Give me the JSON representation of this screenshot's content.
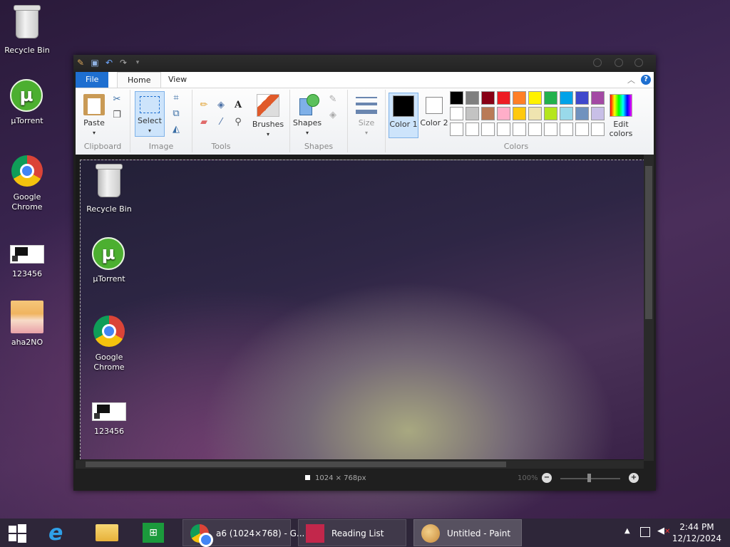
{
  "desktop": {
    "icons": [
      {
        "label": "Recycle Bin"
      },
      {
        "label": "µTorrent"
      },
      {
        "label": "Google Chrome"
      },
      {
        "label": "123456"
      },
      {
        "label": "aha2NO"
      }
    ]
  },
  "paint": {
    "tabs": {
      "file": "File",
      "home": "Home",
      "view": "View"
    },
    "help": "?",
    "clipboard": {
      "paste": "Paste",
      "label": "Clipboard"
    },
    "image": {
      "select": "Select",
      "label": "Image"
    },
    "tools": {
      "label": "Tools",
      "text_tool": "A"
    },
    "brushes": {
      "label": "Brushes"
    },
    "shapes": {
      "button": "Shapes",
      "label": "Shapes"
    },
    "size": {
      "label": "Size"
    },
    "colors": {
      "color1": "Color 1",
      "color2": "Color 2",
      "edit": "Edit colors",
      "label": "Colors",
      "row1": [
        "#000000",
        "#7f7f7f",
        "#880015",
        "#ed1c24",
        "#ff7f27",
        "#fff200",
        "#22b14c",
        "#00a2e8",
        "#3f48cc",
        "#a349a4"
      ],
      "row2": [
        "#ffffff",
        "#c3c3c3",
        "#b97a57",
        "#ffaec9",
        "#ffc90e",
        "#efe4b0",
        "#b5e61d",
        "#99d9ea",
        "#7092be",
        "#c8bfe7"
      ],
      "row3": [
        "#ffffff",
        "#ffffff",
        "#ffffff",
        "#ffffff",
        "#ffffff",
        "#ffffff",
        "#ffffff",
        "#ffffff",
        "#ffffff",
        "#ffffff"
      ]
    },
    "canvas_icons": [
      {
        "label": "Recycle Bin"
      },
      {
        "label": "µTorrent"
      },
      {
        "label": "Google Chrome"
      },
      {
        "label": "123456"
      }
    ],
    "status": {
      "dimensions": "1024 × 768px",
      "zoom": "100%"
    }
  },
  "taskbar": {
    "tasks": [
      {
        "label": "a6 (1024×768) - G..."
      },
      {
        "label": "Reading List"
      },
      {
        "label": "Untitled - Paint"
      }
    ],
    "time": "2:44 PM",
    "date": "12/12/2024"
  }
}
